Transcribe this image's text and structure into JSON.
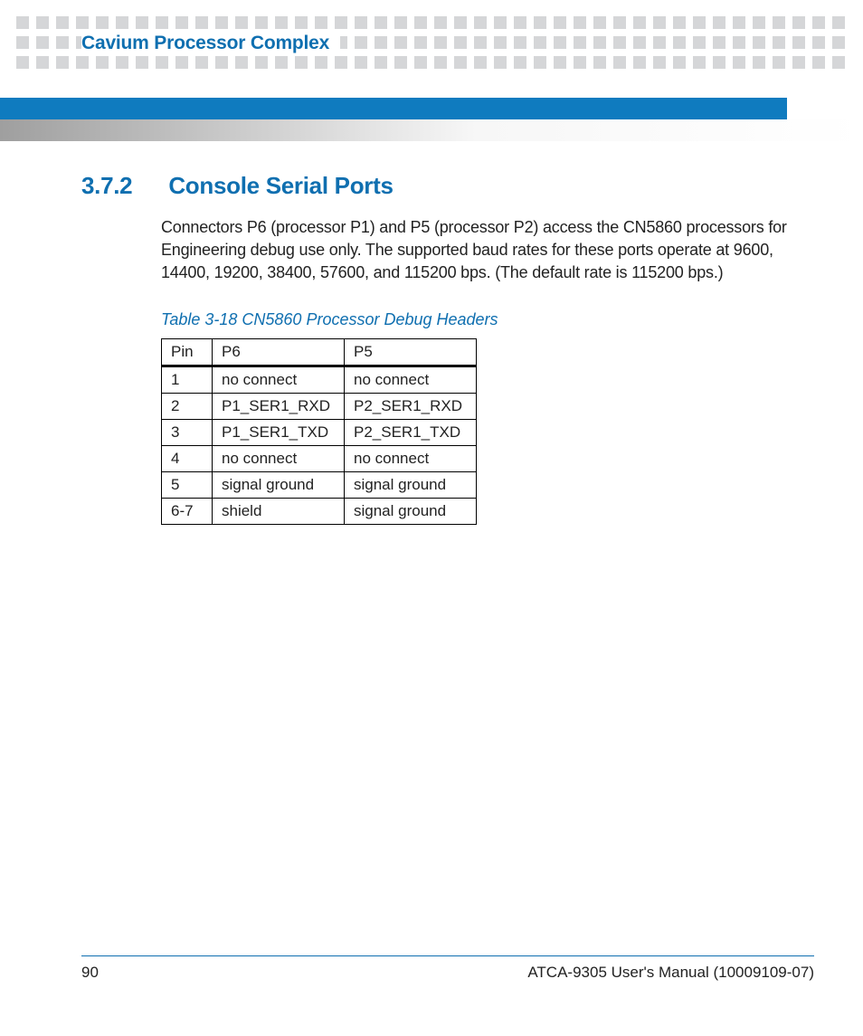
{
  "header": {
    "chapter_title": "Cavium Processor Complex"
  },
  "section": {
    "number": "3.7.2",
    "title": "Console Serial Ports",
    "paragraph": "Connectors P6 (processor P1) and P5 (processor P2) access the CN5860 processors for Engineering debug use only. The supported baud rates for these ports operate at 9600, 14400, 19200, 38400, 57600, and 115200 bps. (The default rate is 115200 bps.)"
  },
  "table": {
    "caption": "Table 3-18 CN5860 Processor Debug Headers",
    "headers": [
      "Pin",
      "P6",
      "P5"
    ],
    "rows": [
      [
        "1",
        "no connect",
        "no connect"
      ],
      [
        "2",
        "P1_SER1_RXD",
        "P2_SER1_RXD"
      ],
      [
        "3",
        "P1_SER1_TXD",
        "P2_SER1_TXD"
      ],
      [
        "4",
        "no connect",
        "no connect"
      ],
      [
        "5",
        "signal ground",
        "signal ground"
      ],
      [
        "6-7",
        "shield",
        "signal ground"
      ]
    ]
  },
  "footer": {
    "page_number": "90",
    "doc_title": "ATCA-9305 User's Manual (10009109-07)"
  }
}
